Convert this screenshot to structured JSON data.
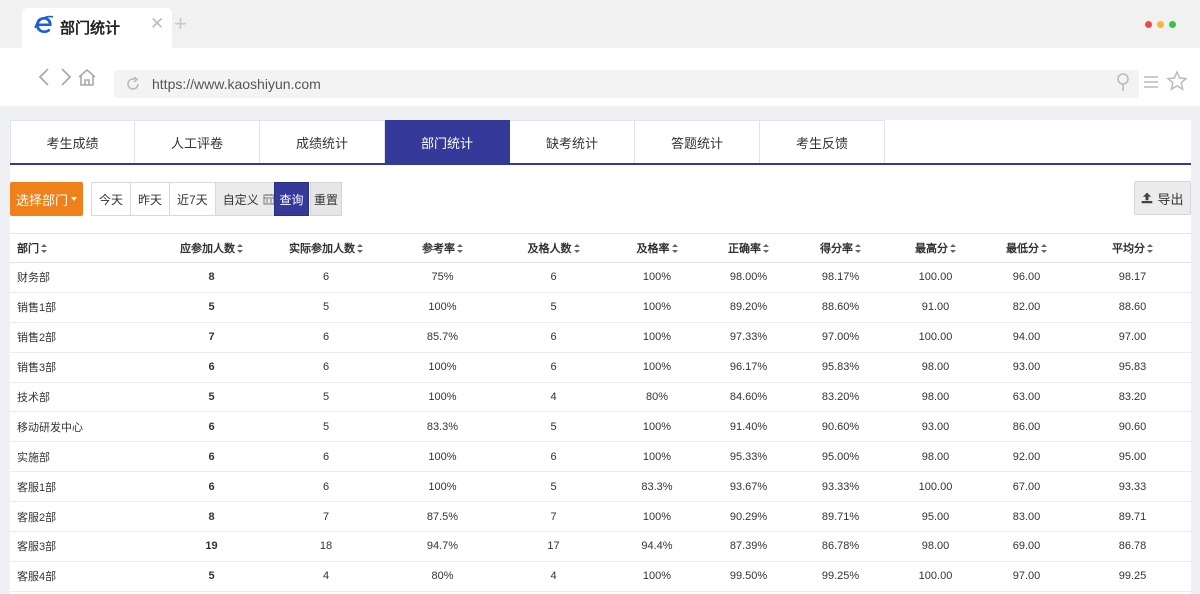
{
  "browser": {
    "tab_title": "部门统计",
    "url": "https://www.kaoshiyun.com",
    "dot_colors": [
      "#e8484f",
      "#f3b83a",
      "#35c24d"
    ]
  },
  "nav_tabs": [
    {
      "label": "考生成绩",
      "active": false
    },
    {
      "label": "人工评卷",
      "active": false
    },
    {
      "label": "成绩统计",
      "active": false
    },
    {
      "label": "部门统计",
      "active": true
    },
    {
      "label": "缺考统计",
      "active": false
    },
    {
      "label": "答题统计",
      "active": false
    },
    {
      "label": "考生反馈",
      "active": false
    }
  ],
  "toolbar": {
    "select_dept": "选择部门",
    "ranges": [
      "今天",
      "昨天",
      "近7天",
      "自定义"
    ],
    "query": "查询",
    "reset": "重置",
    "export": "导出"
  },
  "table": {
    "columns": [
      "部门",
      "应参加人数",
      "实际参加人数",
      "参考率",
      "及格人数",
      "及格率",
      "正确率",
      "得分率",
      "最高分",
      "最低分",
      "平均分"
    ],
    "rows": [
      [
        "财务部",
        "8",
        "6",
        "75%",
        "6",
        "100%",
        "98.00%",
        "98.17%",
        "100.00",
        "96.00",
        "98.17"
      ],
      [
        "销售1部",
        "5",
        "5",
        "100%",
        "5",
        "100%",
        "89.20%",
        "88.60%",
        "91.00",
        "82.00",
        "88.60"
      ],
      [
        "销售2部",
        "7",
        "6",
        "85.7%",
        "6",
        "100%",
        "97.33%",
        "97.00%",
        "100.00",
        "94.00",
        "97.00"
      ],
      [
        "销售3部",
        "6",
        "6",
        "100%",
        "6",
        "100%",
        "96.17%",
        "95.83%",
        "98.00",
        "93.00",
        "95.83"
      ],
      [
        "技术部",
        "5",
        "5",
        "100%",
        "4",
        "80%",
        "84.60%",
        "83.20%",
        "98.00",
        "63.00",
        "83.20"
      ],
      [
        "移动研发中心",
        "6",
        "5",
        "83.3%",
        "5",
        "100%",
        "91.40%",
        "90.60%",
        "93.00",
        "86.00",
        "90.60"
      ],
      [
        "实施部",
        "6",
        "6",
        "100%",
        "6",
        "100%",
        "95.33%",
        "95.00%",
        "98.00",
        "92.00",
        "95.00"
      ],
      [
        "客服1部",
        "6",
        "6",
        "100%",
        "5",
        "83.3%",
        "93.67%",
        "93.33%",
        "100.00",
        "67.00",
        "93.33"
      ],
      [
        "客服2部",
        "8",
        "7",
        "87.5%",
        "7",
        "100%",
        "90.29%",
        "89.71%",
        "95.00",
        "83.00",
        "89.71"
      ],
      [
        "客服3部",
        "19",
        "18",
        "94.7%",
        "17",
        "94.4%",
        "87.39%",
        "86.78%",
        "98.00",
        "69.00",
        "86.78"
      ],
      [
        "客服4部",
        "5",
        "4",
        "80%",
        "4",
        "100%",
        "99.50%",
        "99.25%",
        "100.00",
        "97.00",
        "99.25"
      ]
    ]
  }
}
